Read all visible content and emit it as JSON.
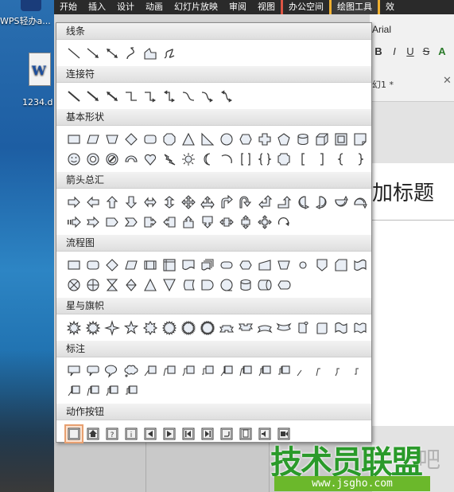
{
  "desktop": {
    "app_label": "WPS轻办a...",
    "doc_file": "1234.d"
  },
  "ribbon": {
    "tabs": [
      {
        "label": "开始",
        "kind": "normal"
      },
      {
        "label": "插入",
        "kind": "normal"
      },
      {
        "label": "设计",
        "kind": "normal"
      },
      {
        "label": "动画",
        "kind": "normal"
      },
      {
        "label": "幻灯片放映",
        "kind": "normal"
      },
      {
        "label": "审阅",
        "kind": "normal"
      },
      {
        "label": "视图",
        "kind": "normal"
      },
      {
        "label": "办公空间",
        "kind": "office"
      },
      {
        "label": "绘图工具",
        "kind": "drawing"
      },
      {
        "label": "效",
        "kind": "extra"
      }
    ]
  },
  "font_panel": {
    "font_name": "Arial",
    "buttons": [
      "B",
      "I",
      "U",
      "S",
      "A"
    ],
    "doc_tab": "幻1 *"
  },
  "slide": {
    "title_fragment": "加标题"
  },
  "shapes_popup": {
    "sections": [
      {
        "title": "线条",
        "rows": [
          [
            "line",
            "arrow",
            "double-arrow",
            "curve",
            "freeform",
            "scribble"
          ]
        ]
      },
      {
        "title": "连接符",
        "rows": [
          [
            "straight-connector",
            "straight-arrow-connector",
            "straight-double-arrow-connector",
            "elbow-connector",
            "elbow-arrow-connector",
            "elbow-double-arrow-connector",
            "curved-connector",
            "curved-arrow-connector",
            "curved-double-arrow-connector"
          ]
        ]
      },
      {
        "title": "基本形状",
        "rows": [
          [
            "rectangle",
            "parallelogram",
            "trapezoid",
            "diamond",
            "rounded-rectangle",
            "octagon",
            "isosceles-triangle",
            "right-triangle",
            "oval",
            "hexagon",
            "cross",
            "pentagon",
            "can",
            "cube",
            "bevel",
            "folded-corner"
          ],
          [
            "smiley-face",
            "donut",
            "no-symbol",
            "block-arc",
            "heart",
            "lightning-bolt",
            "sun",
            "moon",
            "arc",
            "double-bracket",
            "double-brace",
            "plaque",
            "left-bracket",
            "right-bracket",
            "left-brace",
            "right-brace"
          ]
        ]
      },
      {
        "title": "箭头总汇",
        "rows": [
          [
            "right-arrow",
            "left-arrow",
            "up-arrow",
            "down-arrow",
            "left-right-arrow",
            "up-down-arrow",
            "quad-arrow",
            "left-right-up-arrow",
            "bent-arrow",
            "u-turn-arrow",
            "left-up-arrow",
            "bent-up-arrow",
            "curved-right-arrow",
            "curved-left-arrow",
            "curved-up-arrow",
            "curved-down-arrow"
          ],
          [
            "striped-right-arrow",
            "notched-right-arrow",
            "pentagon-arrow",
            "chevron",
            "right-arrow-callout",
            "left-arrow-callout",
            "up-arrow-callout",
            "down-arrow-callout",
            "left-right-arrow-callout",
            "up-down-arrow-callout",
            "quad-arrow-callout",
            "circular-arrow"
          ]
        ]
      },
      {
        "title": "流程图",
        "rows": [
          [
            "process",
            "alternate-process",
            "decision",
            "data",
            "predefined-process",
            "internal-storage",
            "document",
            "multidocument",
            "terminator",
            "preparation",
            "manual-input",
            "manual-operation",
            "connector",
            "off-page-connector",
            "card",
            "punched-tape"
          ],
          [
            "summing-junction",
            "or",
            "collate",
            "sort",
            "extract",
            "merge",
            "stored-data",
            "delay",
            "sequential-access-storage",
            "magnetic-disk",
            "direct-access-storage",
            "display"
          ]
        ]
      },
      {
        "title": "星与旗帜",
        "rows": [
          [
            "explosion-1",
            "explosion-2",
            "4-point-star",
            "5-point-star",
            "8-point-star",
            "16-point-star",
            "24-point-star",
            "32-point-star",
            "up-ribbon",
            "down-ribbon",
            "curved-up-ribbon",
            "curved-down-ribbon",
            "vertical-scroll",
            "horizontal-scroll",
            "wave",
            "double-wave"
          ]
        ]
      },
      {
        "title": "标注",
        "rows": [
          [
            "rectangular-callout",
            "rounded-rectangular-callout",
            "oval-callout",
            "cloud-callout",
            "line-callout-1",
            "line-callout-2",
            "line-callout-3",
            "line-callout-4",
            "line-callout-1-accent",
            "line-callout-2-accent",
            "line-callout-3-accent",
            "line-callout-4-accent",
            "line-callout-1-no-border",
            "line-callout-2-no-border",
            "line-callout-3-no-border",
            "line-callout-4-no-border"
          ],
          [
            "line-callout-1-border-accent",
            "line-callout-2-border-accent",
            "line-callout-3-border-accent",
            "line-callout-4-border-accent"
          ]
        ]
      },
      {
        "title": "动作按钮",
        "rows": [
          [
            "action-custom",
            "action-home",
            "action-help",
            "action-information",
            "action-back",
            "action-forward",
            "action-beginning",
            "action-end",
            "action-return",
            "action-document",
            "action-sound",
            "action-movie"
          ]
        ]
      }
    ],
    "selected_shape": "action-custom"
  },
  "watermark": {
    "text": "技术员联盟",
    "url": "www.jsgho.com",
    "suffix": "吧"
  }
}
